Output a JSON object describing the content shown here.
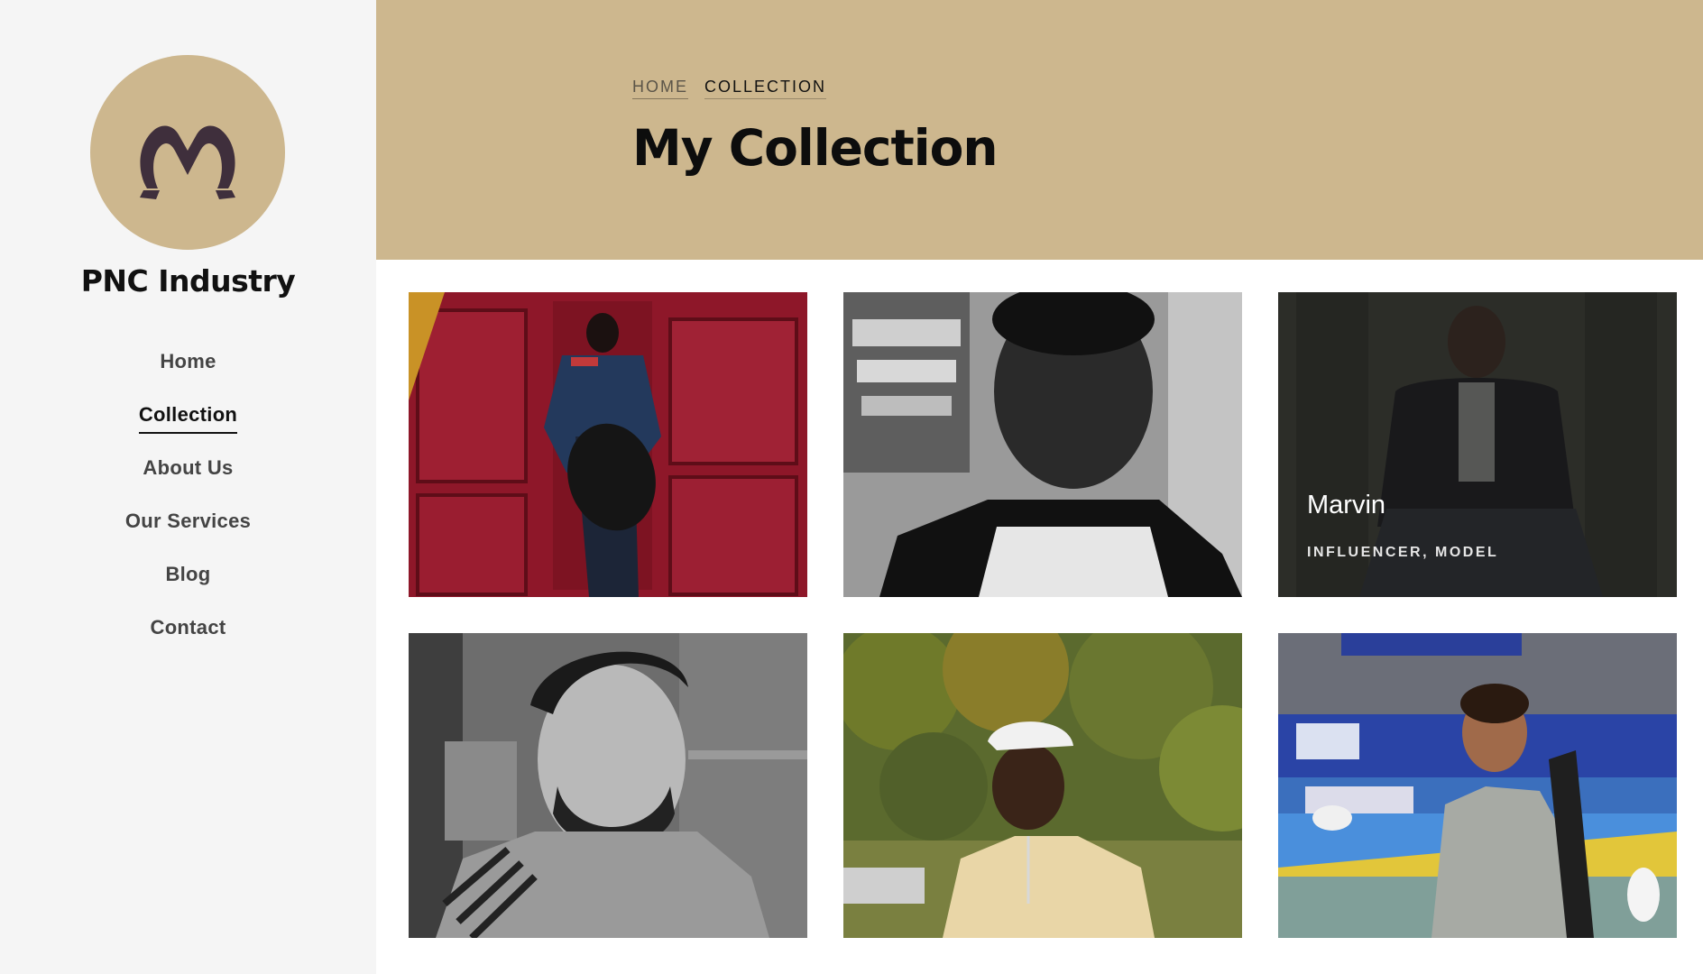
{
  "sidebar": {
    "logo_icon": "heart-hands-icon",
    "brand": "PNC Industry",
    "nav": [
      {
        "label": "Home",
        "active": false
      },
      {
        "label": "Collection",
        "active": true
      },
      {
        "label": "About Us",
        "active": false
      },
      {
        "label": "Our Services",
        "active": false
      },
      {
        "label": "Blog",
        "active": false
      },
      {
        "label": "Contact",
        "active": false
      }
    ]
  },
  "header": {
    "breadcrumb": [
      "HOME",
      "COLLECTION"
    ],
    "title": "My Collection"
  },
  "collection": {
    "items": [
      {
        "photo": "man-red-door-photo"
      },
      {
        "photo": "man-bw-portrait-photo"
      },
      {
        "photo": "man-seated-dark-photo",
        "name": "Marvin",
        "role": "INFLUENCER, MODEL"
      },
      {
        "photo": "man-cap-smiling-bw-photo"
      },
      {
        "photo": "man-white-cap-trees-photo"
      },
      {
        "photo": "man-jiujitsu-arena-photo"
      }
    ]
  },
  "colors": {
    "accent": "#cdb78e",
    "sidebar_bg": "#f5f5f5",
    "text_dark": "#111111"
  }
}
